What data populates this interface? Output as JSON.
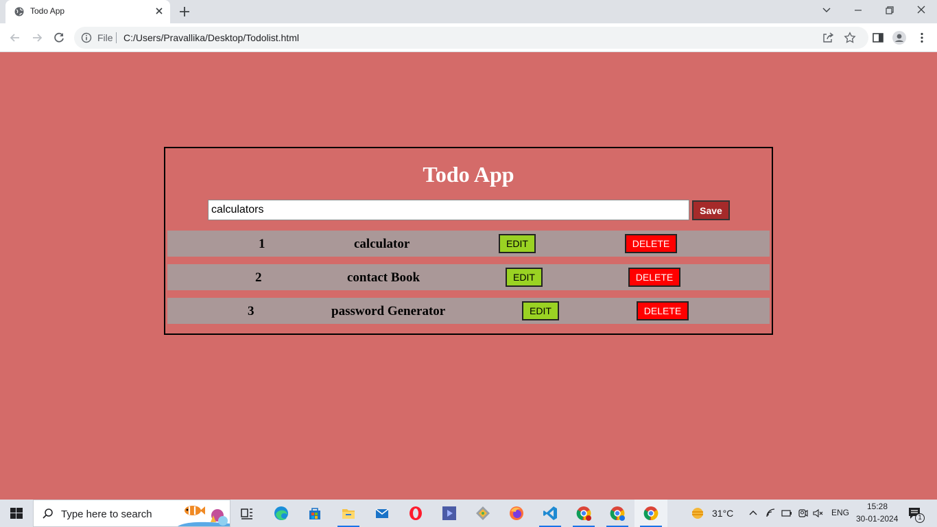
{
  "browser": {
    "tab_title": "Todo App",
    "address_scheme_label": "File",
    "url": "C:/Users/Pravallika/Desktop/Todolist.html"
  },
  "app": {
    "title": "Todo App",
    "input_value": "calculators",
    "save_label": "Save",
    "todos": [
      {
        "number": "1",
        "text": "calculator",
        "edit_label": "EDIT",
        "delete_label": "DELETE"
      },
      {
        "number": "2",
        "text": "contact Book",
        "edit_label": "EDIT",
        "delete_label": "DELETE"
      },
      {
        "number": "3",
        "text": "password Generator",
        "edit_label": "EDIT",
        "delete_label": "DELETE"
      }
    ]
  },
  "taskbar": {
    "search_placeholder": "Type here to search",
    "weather": "31°C",
    "language": "ENG",
    "time": "15:28",
    "date": "30-01-2024",
    "notification_count": "1",
    "pinned_apps": [
      "task-view",
      "edge",
      "store",
      "file-explorer",
      "mail",
      "opera",
      "app-blue",
      "git",
      "firefox",
      "vscode",
      "chrome-p1",
      "chrome-p2",
      "chrome"
    ]
  },
  "colors": {
    "page_background": "#d46b69",
    "row_background": "#aa9898",
    "edit_button": "#9ad223",
    "delete_button": "#ff0000",
    "save_button": "#a52a2a"
  }
}
